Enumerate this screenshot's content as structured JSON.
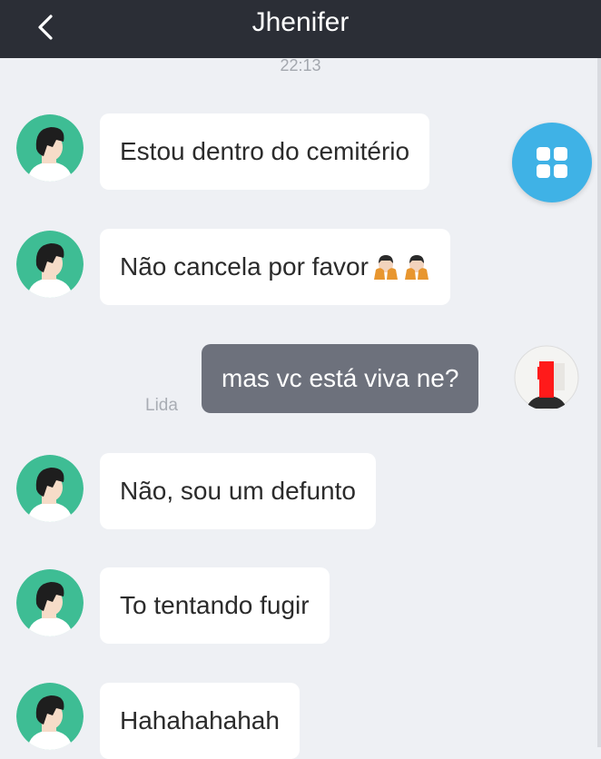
{
  "header": {
    "title": "Jhenifer",
    "back_icon": "chevron-left-icon"
  },
  "timestamp": "22:13",
  "colors": {
    "header_bg": "#2b2e36",
    "chat_bg": "#eef0f4",
    "incoming_bubble": "#ffffff",
    "outgoing_bubble": "#6d717c",
    "avatar_bg": "#3ebd94",
    "fab": "#3fb2e6"
  },
  "messages": [
    {
      "direction": "in",
      "text": "Estou dentro do cemitério"
    },
    {
      "direction": "in",
      "text": "Não cancela por favor",
      "emoji": [
        "pleading-hands-emoji",
        "pleading-hands-emoji"
      ]
    },
    {
      "direction": "out",
      "text": "mas vc está viva ne?",
      "status": "Lida"
    },
    {
      "direction": "in",
      "text": "Não, sou um defunto"
    },
    {
      "direction": "in",
      "text": "To tentando fugir"
    },
    {
      "direction": "in",
      "text": "Hahahahahah"
    }
  ],
  "fab": {
    "icon": "grid-menu-icon"
  }
}
